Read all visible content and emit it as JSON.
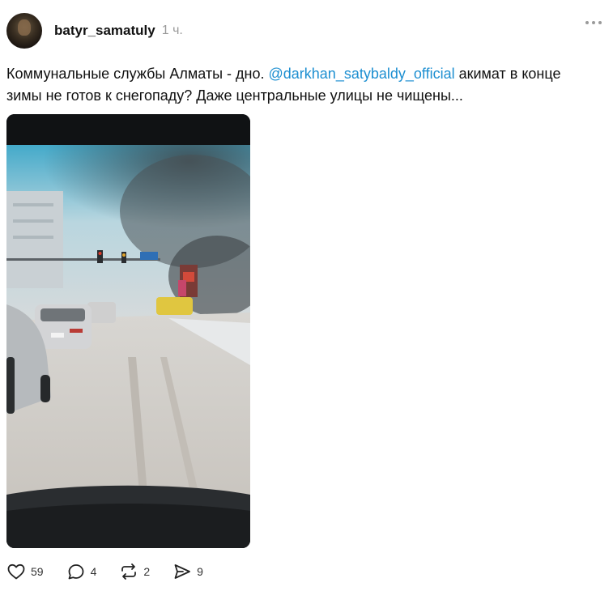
{
  "post": {
    "username": "batyr_samatuly",
    "time": "1 ч.",
    "text_before": "Коммунальные службы Алматы - дно. ",
    "mention": "@darkhan_satybaldy_official",
    "text_after": " акимат в конце зимы не готов к снегопаду? Даже центральные улицы не чищены..."
  },
  "actions": {
    "likes": "59",
    "comments": "4",
    "reposts": "2",
    "shares": "9"
  },
  "icons": {
    "more": "more-dots-icon",
    "like": "heart-icon",
    "comment": "comment-bubble-icon",
    "repost": "repost-icon",
    "share": "send-icon"
  },
  "colors": {
    "mention": "#1d8fd1",
    "muted": "#9a9a9a"
  }
}
